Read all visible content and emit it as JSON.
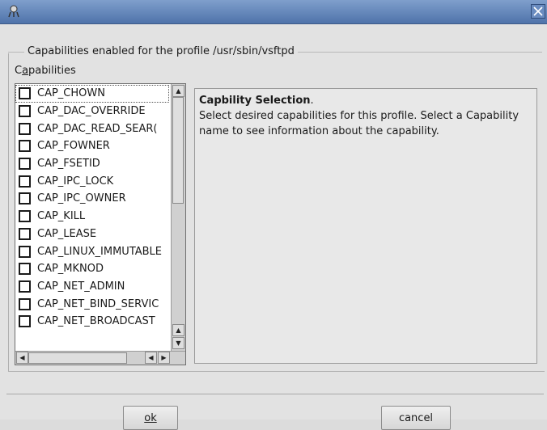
{
  "dialog": {
    "group_title": "Capabilities enabled for the profile /usr/sbin/vsftpd",
    "list_label": "Capabilities",
    "list_label_underline_char": "a"
  },
  "capabilities": [
    {
      "name": "CAP_CHOWN",
      "checked": false
    },
    {
      "name": "CAP_DAC_OVERRIDE",
      "checked": false
    },
    {
      "name": "CAP_DAC_READ_SEAR(",
      "checked": false
    },
    {
      "name": "CAP_FOWNER",
      "checked": false
    },
    {
      "name": "CAP_FSETID",
      "checked": false
    },
    {
      "name": "CAP_IPC_LOCK",
      "checked": false
    },
    {
      "name": "CAP_IPC_OWNER",
      "checked": false
    },
    {
      "name": "CAP_KILL",
      "checked": false
    },
    {
      "name": "CAP_LEASE",
      "checked": false
    },
    {
      "name": "CAP_LINUX_IMMUTABLE",
      "checked": false
    },
    {
      "name": "CAP_MKNOD",
      "checked": false
    },
    {
      "name": "CAP_NET_ADMIN",
      "checked": false
    },
    {
      "name": "CAP_NET_BIND_SERVIC",
      "checked": false
    },
    {
      "name": "CAP_NET_BROADCAST",
      "checked": false
    }
  ],
  "info": {
    "title": "Capbility Selection",
    "title_suffix": ".",
    "body": "Select desired capabilities for this profile. Select a Capability name to see information about the capability."
  },
  "buttons": {
    "ok": "ok",
    "cancel": "cancel"
  },
  "colors": {
    "titlebar": "#5f82b8",
    "window_bg": "#e2e2e2"
  }
}
